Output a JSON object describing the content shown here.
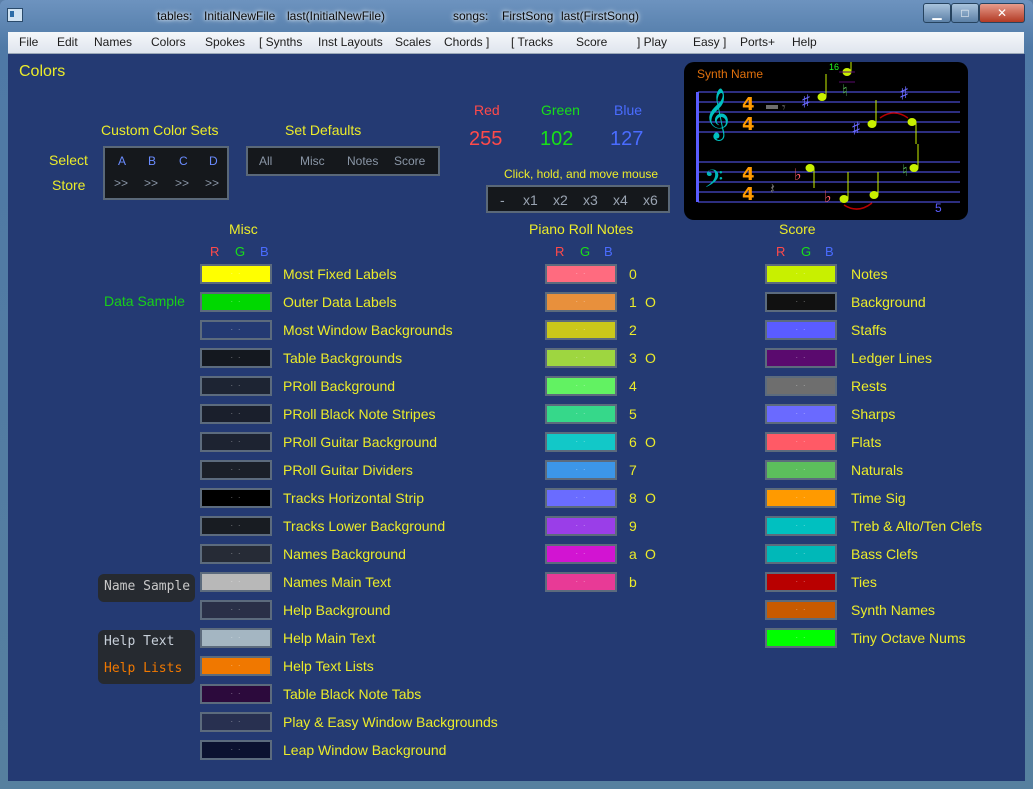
{
  "titlebar": {
    "tables_label": "tables:",
    "tables_file": "InitialNewFile",
    "tables_last": "last(InitialNewFile)",
    "songs_label": "songs:",
    "songs_file": "FirstSong",
    "songs_last": "last(FirstSong)",
    "min": "▁",
    "max": "□",
    "close": "✕"
  },
  "menu": [
    "File",
    "Edit",
    "Names",
    "Colors",
    "Spokes",
    "[  Synths",
    "Inst Layouts",
    "Scales",
    "Chords  ]",
    "[  Tracks",
    "Score",
    "]  Play",
    "Easy  ]",
    "Ports+",
    "Help"
  ],
  "page_title": "Colors",
  "custom_sets": {
    "title": "Custom Color Sets",
    "select": "Select",
    "store": "Store",
    "letters": [
      "A",
      "B",
      "C",
      "D"
    ],
    "store_btns": [
      ">>",
      ">>",
      ">>",
      ">>"
    ]
  },
  "defaults": {
    "title": "Set Defaults",
    "buttons": [
      "All",
      "Misc",
      "Notes",
      "Score"
    ]
  },
  "rgb_header": {
    "red_label": "Red",
    "red_value": "255",
    "green_label": "Green",
    "green_value": "102",
    "blue_label": "Blue",
    "blue_value": "127",
    "hint": "Click, hold, and move mouse",
    "multipliers": [
      "-",
      "x1",
      "x2",
      "x3",
      "x4",
      "x6"
    ]
  },
  "preview": {
    "synth_name": "Synth Name",
    "octave_num": "16",
    "measure_num": "5",
    "time_sig": "4"
  },
  "rgb_letters": [
    "R",
    "G",
    "B"
  ],
  "misc": {
    "title": "Misc",
    "data_sample": "Data Sample",
    "name_sample": "Name Sample",
    "help_text": "Help Text",
    "help_lists": "Help Lists",
    "items": [
      {
        "label": "Most Fixed Labels",
        "color": "#ffff00"
      },
      {
        "label": "Outer Data Labels",
        "color": "#00d800"
      },
      {
        "label": "Most Window Backgrounds",
        "color": "#243a73"
      },
      {
        "label": "Table Backgrounds",
        "color": "#14181f"
      },
      {
        "label": "PRoll Background",
        "color": "#1d2433"
      },
      {
        "label": "PRoll Black Note Stripes",
        "color": "#1a1f2c"
      },
      {
        "label": "PRoll Guitar Background",
        "color": "#1d2331"
      },
      {
        "label": "PRoll Guitar Dividers",
        "color": "#1b2029"
      },
      {
        "label": "Tracks Horizontal Strip",
        "color": "#000000"
      },
      {
        "label": "Tracks Lower Background",
        "color": "#181c22"
      },
      {
        "label": "Names Background",
        "color": "#262b36"
      },
      {
        "label": "Names Main Text",
        "color": "#b8b8b8"
      },
      {
        "label": "Help Background",
        "color": "#2a3048"
      },
      {
        "label": "Help Main Text",
        "color": "#a4b6c2"
      },
      {
        "label": "Help Text Lists",
        "color": "#f07800"
      },
      {
        "label": "Table Black Note Tabs",
        "color": "#2c0a3c"
      },
      {
        "label": "Play & Easy Window Backgrounds",
        "color": "#283050"
      },
      {
        "label": "Leap Window Background",
        "color": "#0c1230"
      }
    ]
  },
  "proll": {
    "title": "Piano Roll Notes",
    "items": [
      {
        "label": "0",
        "mark": "",
        "color": "#ff6b7f"
      },
      {
        "label": "1",
        "mark": "O",
        "color": "#e8903c"
      },
      {
        "label": "2",
        "mark": "",
        "color": "#cbc81a"
      },
      {
        "label": "3",
        "mark": "O",
        "color": "#9ed640"
      },
      {
        "label": "4",
        "mark": "",
        "color": "#62f262"
      },
      {
        "label": "5",
        "mark": "",
        "color": "#36d88a"
      },
      {
        "label": "6",
        "mark": "O",
        "color": "#12c8c8"
      },
      {
        "label": "7",
        "mark": "",
        "color": "#3c96e8"
      },
      {
        "label": "8",
        "mark": "O",
        "color": "#6a6cff"
      },
      {
        "label": "9",
        "mark": "",
        "color": "#9a3ee8"
      },
      {
        "label": "a",
        "mark": "O",
        "color": "#d214d2"
      },
      {
        "label": "b",
        "mark": "",
        "color": "#e83a96"
      }
    ]
  },
  "score": {
    "title": "Score",
    "items": [
      {
        "label": "Notes",
        "color": "#c8f000"
      },
      {
        "label": "Background",
        "color": "#111111"
      },
      {
        "label": "Staffs",
        "color": "#5a5cff"
      },
      {
        "label": "Ledger Lines",
        "color": "#5a0a6e"
      },
      {
        "label": "Rests",
        "color": "#6e6e6e"
      },
      {
        "label": "Sharps",
        "color": "#6a6aff"
      },
      {
        "label": "Flats",
        "color": "#ff5a66"
      },
      {
        "label": "Naturals",
        "color": "#5cbe5c"
      },
      {
        "label": "Time Sig",
        "color": "#ff9a00"
      },
      {
        "label": "Treb & Alto/Ten Clefs",
        "color": "#00c0c0"
      },
      {
        "label": "Bass Clefs",
        "color": "#00b8b8"
      },
      {
        "label": "Ties",
        "color": "#b80000"
      },
      {
        "label": "Synth Names",
        "color": "#c85a00"
      },
      {
        "label": "Tiny Octave Nums",
        "color": "#00ff00"
      }
    ]
  }
}
